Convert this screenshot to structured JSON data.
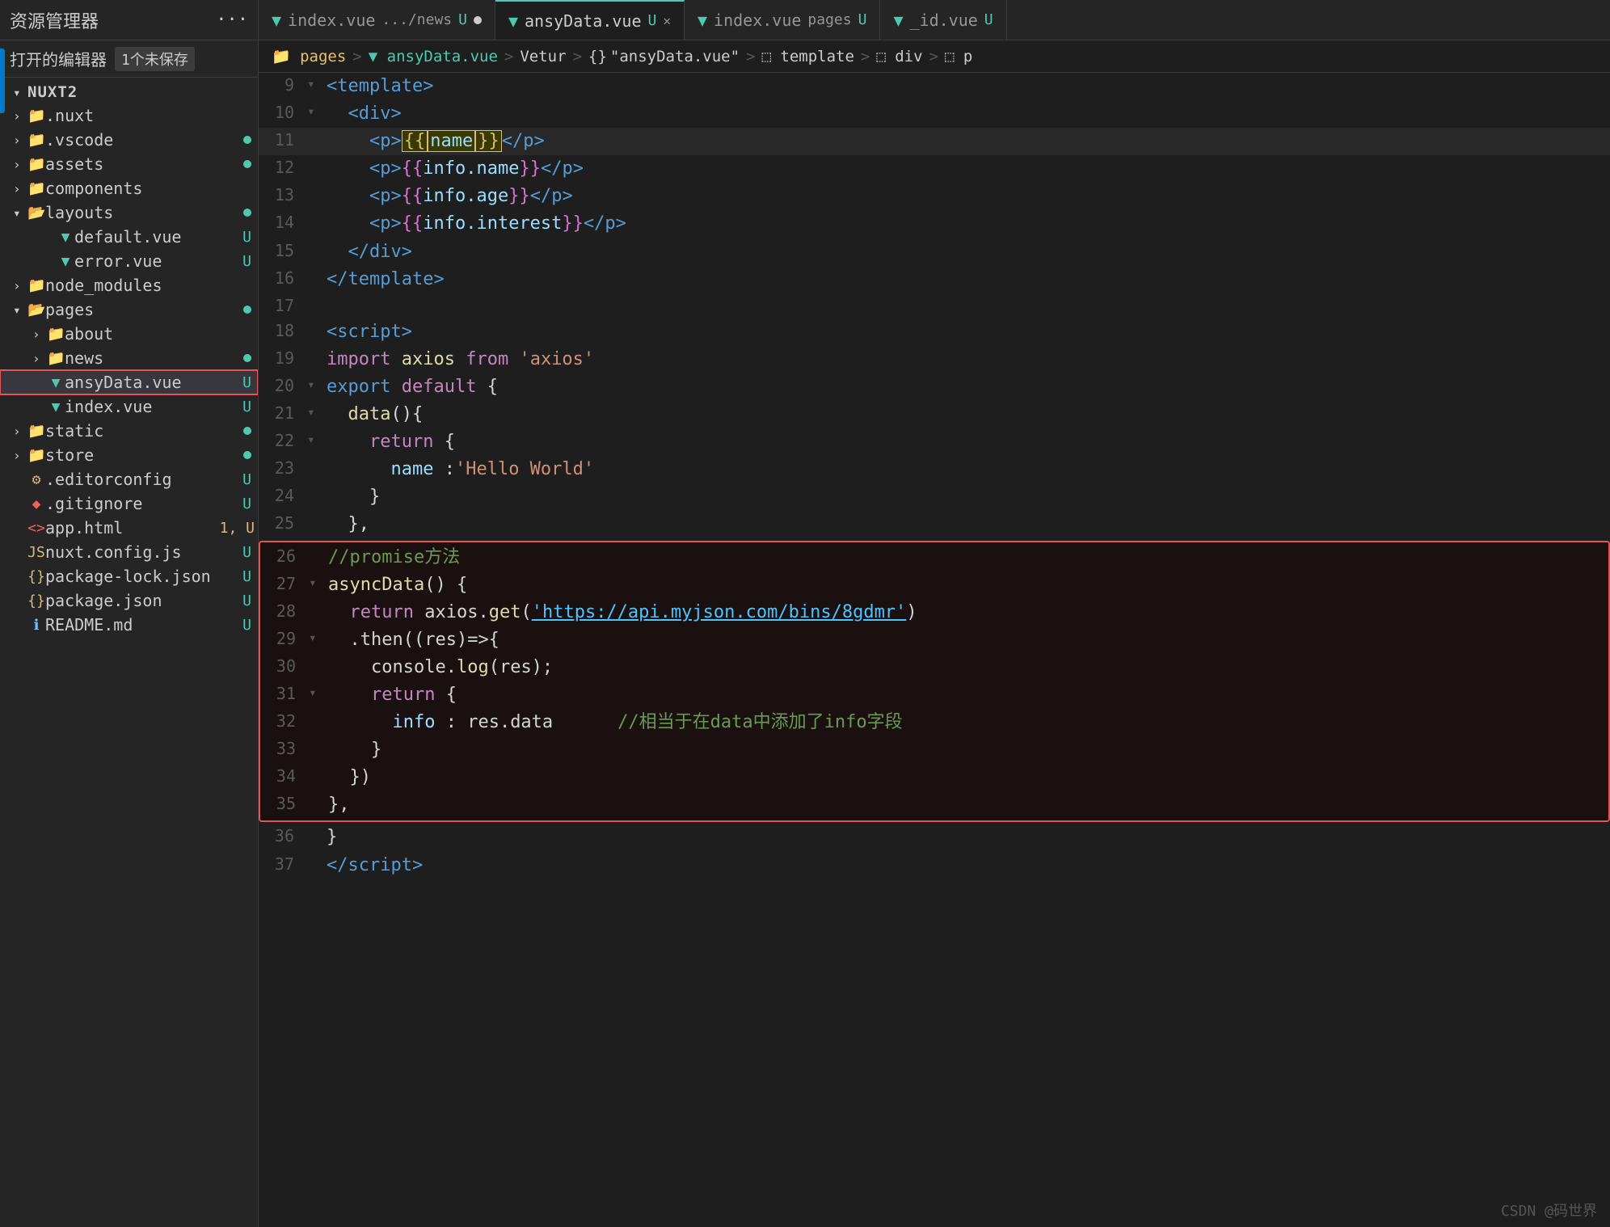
{
  "sidebar": {
    "title": "资源管理器",
    "dots": "···",
    "open_editors_label": "打开的编辑器",
    "unsaved_badge": "1个未保存",
    "root_label": "NUXT2",
    "items": [
      {
        "id": "nuxt",
        "name": ".nuxt",
        "indent": 1,
        "type": "folder",
        "collapsed": true,
        "has_dot": false
      },
      {
        "id": "vscode",
        "name": ".vscode",
        "indent": 1,
        "type": "folder",
        "collapsed": true,
        "has_dot": true
      },
      {
        "id": "assets",
        "name": "assets",
        "indent": 1,
        "type": "folder",
        "collapsed": true,
        "has_dot": true
      },
      {
        "id": "components",
        "name": "components",
        "indent": 1,
        "type": "folder",
        "collapsed": true,
        "has_dot": false
      },
      {
        "id": "layouts",
        "name": "layouts",
        "indent": 1,
        "type": "folder",
        "collapsed": false,
        "has_dot": true
      },
      {
        "id": "default-vue",
        "name": "default.vue",
        "indent": 2,
        "type": "vue",
        "badge": "U"
      },
      {
        "id": "error-vue",
        "name": "error.vue",
        "indent": 2,
        "type": "vue",
        "badge": "U"
      },
      {
        "id": "node_modules",
        "name": "node_modules",
        "indent": 1,
        "type": "folder",
        "collapsed": true,
        "has_dot": false
      },
      {
        "id": "pages",
        "name": "pages",
        "indent": 1,
        "type": "folder",
        "collapsed": false,
        "has_dot": true
      },
      {
        "id": "about",
        "name": "about",
        "indent": 2,
        "type": "folder",
        "collapsed": true,
        "has_dot": false
      },
      {
        "id": "news",
        "name": "news",
        "indent": 2,
        "type": "folder",
        "collapsed": true,
        "has_dot": true
      },
      {
        "id": "ansyData-vue",
        "name": "ansyData.vue",
        "indent": 2,
        "type": "vue",
        "badge": "U",
        "selected": true,
        "highlighted": true
      },
      {
        "id": "index-vue",
        "name": "index.vue",
        "indent": 2,
        "type": "vue",
        "badge": "U"
      },
      {
        "id": "static",
        "name": "static",
        "indent": 1,
        "type": "folder",
        "collapsed": true,
        "has_dot": true
      },
      {
        "id": "store",
        "name": "store",
        "indent": 1,
        "type": "folder",
        "collapsed": true,
        "has_dot": true
      },
      {
        "id": "editorconfig",
        "name": ".editorconfig",
        "indent": 1,
        "type": "settings",
        "badge": "U"
      },
      {
        "id": "gitignore",
        "name": ".gitignore",
        "indent": 1,
        "type": "git",
        "badge": "U"
      },
      {
        "id": "app-html",
        "name": "app.html",
        "indent": 1,
        "type": "html",
        "badge": "1, U"
      },
      {
        "id": "nuxt-config",
        "name": "nuxt.config.js",
        "indent": 1,
        "type": "js",
        "badge": "U"
      },
      {
        "id": "package-lock",
        "name": "package-lock.json",
        "indent": 1,
        "type": "json",
        "badge": "U"
      },
      {
        "id": "package-json",
        "name": "package.json",
        "indent": 1,
        "type": "json",
        "badge": "U"
      },
      {
        "id": "readme",
        "name": "README.md",
        "indent": 1,
        "type": "info",
        "badge": "U"
      }
    ]
  },
  "tabs": [
    {
      "id": "tab1",
      "name": "index.vue",
      "path": ".../news",
      "badge": "U",
      "dot": true,
      "active": false
    },
    {
      "id": "tab2",
      "name": "ansyData.vue",
      "path": "",
      "badge": "U",
      "close": true,
      "active": true
    },
    {
      "id": "tab3",
      "name": "index.vue",
      "path": "pages",
      "badge": "U",
      "active": false
    },
    {
      "id": "tab4",
      "name": "_id.vue",
      "path": "",
      "badge": "U",
      "active": false
    }
  ],
  "breadcrumb": [
    {
      "label": "pages",
      "type": "folder"
    },
    {
      "label": "ansyData.vue",
      "type": "vue"
    },
    {
      "label": "Vetur",
      "type": "text"
    },
    {
      "label": "{}",
      "type": "text"
    },
    {
      "label": "\"ansyData.vue\"",
      "type": "text"
    },
    {
      "label": "template",
      "type": "icon"
    },
    {
      "label": "div",
      "type": "icon"
    },
    {
      "label": "p",
      "type": "icon"
    }
  ],
  "code_lines": [
    {
      "num": 9,
      "arrow": "▾",
      "content_parts": [
        {
          "text": "<",
          "cls": "c-tag"
        },
        {
          "text": "template",
          "cls": "c-tag"
        },
        {
          "text": ">",
          "cls": "c-tag"
        }
      ]
    },
    {
      "num": 10,
      "arrow": "▾",
      "indent": 2,
      "content_parts": [
        {
          "text": "<",
          "cls": "c-tag"
        },
        {
          "text": "div",
          "cls": "c-tag"
        },
        {
          "text": ">",
          "cls": "c-tag"
        }
      ]
    },
    {
      "num": 11,
      "indent": 4,
      "content_parts": [
        {
          "text": "<",
          "cls": "c-tag"
        },
        {
          "text": "p",
          "cls": "c-tag"
        },
        {
          "text": ">",
          "cls": "c-tag"
        },
        {
          "text": "{{",
          "cls": "c-bracket-yellow"
        },
        {
          "text": "name",
          "cls": "c-var",
          "highlight": true
        },
        {
          "text": "}}",
          "cls": "c-bracket-yellow",
          "highlight": true
        },
        {
          "text": "</",
          "cls": "c-tag"
        },
        {
          "text": "p",
          "cls": "c-tag"
        },
        {
          "text": ">",
          "cls": "c-tag"
        }
      ]
    },
    {
      "num": 12,
      "indent": 4,
      "content_parts": [
        {
          "text": "<",
          "cls": "c-tag"
        },
        {
          "text": "p",
          "cls": "c-tag"
        },
        {
          "text": ">",
          "cls": "c-tag"
        },
        {
          "text": "{{",
          "cls": "c-bracket-pink"
        },
        {
          "text": "info.name",
          "cls": "c-var"
        },
        {
          "text": "}}",
          "cls": "c-bracket-pink"
        },
        {
          "text": "</",
          "cls": "c-tag"
        },
        {
          "text": "p",
          "cls": "c-tag"
        },
        {
          "text": ">",
          "cls": "c-tag"
        }
      ]
    },
    {
      "num": 13,
      "indent": 4,
      "content_parts": [
        {
          "text": "<",
          "cls": "c-tag"
        },
        {
          "text": "p",
          "cls": "c-tag"
        },
        {
          "text": ">",
          "cls": "c-tag"
        },
        {
          "text": "{{",
          "cls": "c-bracket-pink"
        },
        {
          "text": "info.age",
          "cls": "c-var"
        },
        {
          "text": "}}",
          "cls": "c-bracket-pink"
        },
        {
          "text": "</",
          "cls": "c-tag"
        },
        {
          "text": "p",
          "cls": "c-tag"
        },
        {
          "text": ">",
          "cls": "c-tag"
        }
      ]
    },
    {
      "num": 14,
      "indent": 4,
      "content_parts": [
        {
          "text": "<",
          "cls": "c-tag"
        },
        {
          "text": "p",
          "cls": "c-tag"
        },
        {
          "text": ">",
          "cls": "c-tag"
        },
        {
          "text": "{{",
          "cls": "c-bracket-pink"
        },
        {
          "text": "info.interest",
          "cls": "c-var"
        },
        {
          "text": "}}",
          "cls": "c-bracket-pink"
        },
        {
          "text": "</",
          "cls": "c-tag"
        },
        {
          "text": "p",
          "cls": "c-tag"
        },
        {
          "text": ">",
          "cls": "c-tag"
        }
      ]
    },
    {
      "num": 15,
      "indent": 2,
      "content_parts": [
        {
          "text": "</",
          "cls": "c-tag"
        },
        {
          "text": "div",
          "cls": "c-tag"
        },
        {
          "text": ">",
          "cls": "c-tag"
        }
      ]
    },
    {
      "num": 16,
      "content_parts": [
        {
          "text": "</",
          "cls": "c-tag"
        },
        {
          "text": "template",
          "cls": "c-tag"
        },
        {
          "text": ">",
          "cls": "c-tag"
        }
      ]
    },
    {
      "num": 17,
      "content_parts": []
    },
    {
      "num": 18,
      "content_parts": [
        {
          "text": "<",
          "cls": "c-tag"
        },
        {
          "text": "script",
          "cls": "c-tag"
        },
        {
          "text": ">",
          "cls": "c-tag"
        }
      ]
    },
    {
      "num": 19,
      "indent": 0,
      "content_parts": [
        {
          "text": "import",
          "cls": "c-keyword"
        },
        {
          "text": " axios ",
          "cls": "c-white"
        },
        {
          "text": "from",
          "cls": "c-keyword"
        },
        {
          "text": " 'axios'",
          "cls": "c-orange"
        }
      ]
    },
    {
      "num": 20,
      "arrow": "▾",
      "content_parts": [
        {
          "text": "export",
          "cls": "c-keyword2"
        },
        {
          "text": " default {",
          "cls": "c-white"
        }
      ]
    },
    {
      "num": 21,
      "arrow": "▾",
      "indent": 2,
      "content_parts": [
        {
          "text": "data",
          "cls": "c-fn"
        },
        {
          "text": "(){",
          "cls": "c-white"
        }
      ]
    },
    {
      "num": 22,
      "arrow": "▾",
      "indent": 4,
      "content_parts": [
        {
          "text": "return {",
          "cls": "c-white"
        }
      ]
    },
    {
      "num": 23,
      "indent": 6,
      "content_parts": [
        {
          "text": "name",
          "cls": "c-var"
        },
        {
          "text": " :",
          "cls": "c-white"
        },
        {
          "text": "'Hello World'",
          "cls": "c-orange"
        }
      ]
    },
    {
      "num": 24,
      "indent": 4,
      "content_parts": [
        {
          "text": "}",
          "cls": "c-white"
        }
      ]
    },
    {
      "num": 25,
      "indent": 2,
      "content_parts": [
        {
          "text": "},",
          "cls": "c-white"
        }
      ]
    },
    {
      "num": 26,
      "indent": 0,
      "content_parts": [
        {
          "text": "//promise方法",
          "cls": "c-comment"
        }
      ],
      "highlight_box_start": true
    },
    {
      "num": 27,
      "arrow": "▾",
      "indent": 0,
      "content_parts": [
        {
          "text": "asyncData",
          "cls": "c-fn"
        },
        {
          "text": "() {",
          "cls": "c-white"
        }
      ]
    },
    {
      "num": 28,
      "indent": 2,
      "content_parts": [
        {
          "text": "return",
          "cls": "c-keyword"
        },
        {
          "text": " axios.",
          "cls": "c-white"
        },
        {
          "text": "get",
          "cls": "c-fn"
        },
        {
          "text": "(",
          "cls": "c-white"
        },
        {
          "text": "'https://api.myjson.com/bins/8gdmr'",
          "cls": "c-url"
        },
        {
          "text": ")",
          "cls": "c-white"
        }
      ]
    },
    {
      "num": 29,
      "arrow": "▾",
      "indent": 2,
      "content_parts": [
        {
          "text": ".then((res)=>{",
          "cls": "c-white"
        }
      ]
    },
    {
      "num": 30,
      "indent": 4,
      "content_parts": [
        {
          "text": "console.",
          "cls": "c-white"
        },
        {
          "text": "log",
          "cls": "c-fn"
        },
        {
          "text": "(res);",
          "cls": "c-white"
        }
      ]
    },
    {
      "num": 31,
      "arrow": "▾",
      "indent": 4,
      "content_parts": [
        {
          "text": "return {",
          "cls": "c-white"
        }
      ]
    },
    {
      "num": 32,
      "indent": 6,
      "content_parts": [
        {
          "text": "info",
          "cls": "c-var"
        },
        {
          "text": " : res.data",
          "cls": "c-white"
        },
        {
          "text": "          //相当于在data中添加了info字段",
          "cls": "c-comment"
        }
      ]
    },
    {
      "num": 33,
      "indent": 4,
      "content_parts": [
        {
          "text": "}",
          "cls": "c-white"
        }
      ]
    },
    {
      "num": 34,
      "indent": 2,
      "content_parts": [
        {
          "text": "})",
          "cls": "c-white"
        }
      ]
    },
    {
      "num": 35,
      "indent": 0,
      "content_parts": [
        {
          "text": "},",
          "cls": "c-white"
        }
      ],
      "highlight_box_end": true
    },
    {
      "num": 36,
      "content_parts": [
        {
          "text": "}",
          "cls": "c-white"
        }
      ]
    },
    {
      "num": 37,
      "content_parts": [
        {
          "text": "</",
          "cls": "c-tag"
        },
        {
          "text": "script",
          "cls": "c-tag"
        },
        {
          "text": ">",
          "cls": "c-tag"
        }
      ]
    }
  ],
  "watermark": "CSDN @码世界"
}
